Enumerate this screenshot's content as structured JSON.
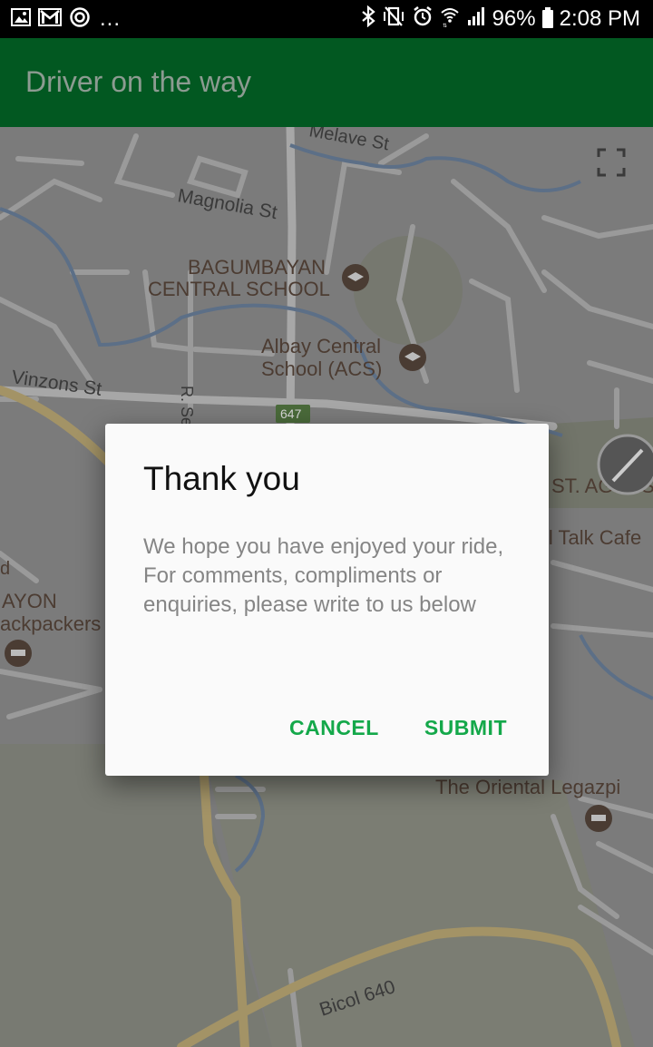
{
  "status_bar": {
    "left_icons": [
      "image-icon",
      "gmail-icon",
      "data-saver-icon"
    ],
    "more": "...",
    "right_icons": [
      "bluetooth-icon",
      "vibrate-icon",
      "alarm-icon",
      "wifi-icon",
      "signal-icon",
      "battery-icon"
    ],
    "battery": "96%",
    "time": "2:08 PM"
  },
  "app_bar": {
    "title": "Driver on the way"
  },
  "map": {
    "labels": {
      "melave": "Melave St",
      "magnolia": "Magnolia St",
      "bagumbayan_1": "BAGUMBAYAN",
      "bagumbayan_2": "CENTRAL SCHOOL",
      "albay_1": "Albay Central",
      "albay_2": "School (ACS)",
      "vinzons": "Vinzons St",
      "r_se": "R. Se",
      "route_647": "647",
      "st_agnes": "ST. AGNES",
      "talk_cafe": "ll Talk Cafe",
      "ayon": "AYON",
      "backpackers": "ackpackers",
      "d": "d",
      "oriental": "The Oriental Legazpi",
      "bicol": "Bicol 640"
    }
  },
  "dialog": {
    "title": "Thank you",
    "message": "We hope you have enjoyed your ride, For comments, compliments or enquiries, please write to us below",
    "cancel_label": "CANCEL",
    "submit_label": "SUBMIT"
  },
  "colors": {
    "app_bar": "#025821",
    "accent": "#14a84a"
  }
}
